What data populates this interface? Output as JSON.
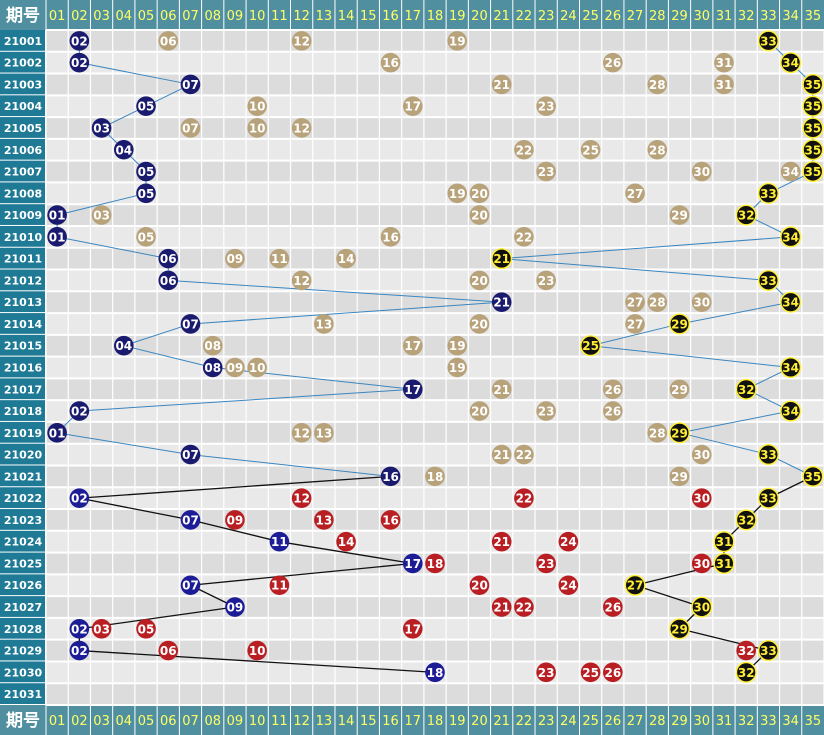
{
  "chart_data": {
    "type": "table",
    "header_label": "期号",
    "columns": [
      "01",
      "02",
      "03",
      "04",
      "05",
      "06",
      "07",
      "08",
      "09",
      "10",
      "11",
      "12",
      "13",
      "14",
      "15",
      "16",
      "17",
      "18",
      "19",
      "20",
      "21",
      "22",
      "23",
      "24",
      "25",
      "26",
      "27",
      "28",
      "29",
      "30",
      "31",
      "32",
      "33",
      "34",
      "35"
    ],
    "periods": [
      "21001",
      "21002",
      "21003",
      "21004",
      "21005",
      "21006",
      "21007",
      "21008",
      "21009",
      "21010",
      "21011",
      "21012",
      "21013",
      "21014",
      "21015",
      "21016",
      "21017",
      "21018",
      "21019",
      "21020",
      "21021",
      "21022",
      "21023",
      "21024",
      "21025",
      "21026",
      "21027",
      "21028",
      "21029",
      "21030",
      "21031"
    ],
    "line_series": [
      {
        "kind": "min",
        "values": [
          2,
          2,
          7,
          5,
          3,
          4,
          5,
          5,
          1,
          1,
          6,
          6,
          21,
          7,
          4,
          8,
          17,
          2,
          1,
          7,
          16,
          2,
          7,
          11,
          17,
          7,
          9,
          2,
          2,
          18
        ]
      },
      {
        "kind": "max",
        "values": [
          33,
          34,
          35,
          35,
          35,
          35,
          35,
          33,
          32,
          34,
          21,
          33,
          34,
          29,
          25,
          34,
          32,
          34,
          29,
          33,
          35,
          33,
          32,
          31,
          31,
          27,
          30,
          29,
          33,
          32
        ]
      }
    ],
    "other_numbers": [
      [
        6,
        12,
        19
      ],
      [
        16,
        26,
        31
      ],
      [
        21,
        28,
        31
      ],
      [
        10,
        17,
        23
      ],
      [
        7,
        10,
        12
      ],
      [
        22,
        25,
        28
      ],
      [
        23,
        30,
        34
      ],
      [
        19,
        20,
        27
      ],
      [
        3,
        20,
        29
      ],
      [
        5,
        16,
        22
      ],
      [
        9,
        11,
        14
      ],
      [
        12,
        20,
        23
      ],
      [
        27,
        28,
        30
      ],
      [
        13,
        20,
        27
      ],
      [
        8,
        17,
        19
      ],
      [
        9,
        10,
        19
      ],
      [
        21,
        26,
        29
      ],
      [
        20,
        23,
        26
      ],
      [
        12,
        13,
        28
      ],
      [
        21,
        22,
        30
      ],
      [
        18,
        29
      ],
      [
        12,
        22,
        30
      ],
      [
        9,
        13,
        16
      ],
      [
        14,
        21,
        24
      ],
      [
        18,
        23,
        30
      ],
      [
        11,
        20,
        24
      ],
      [
        21,
        22,
        26
      ],
      [
        3,
        5,
        17
      ],
      [
        6,
        10,
        32
      ],
      [
        23,
        25,
        26
      ]
    ],
    "colors": {
      "header_bg": "#4f8fa0",
      "header_text": "#ffff66",
      "period_bg": "#1f7a96",
      "row_bg_a": "#dcdcdc",
      "row_bg_b": "#e9e9e9",
      "min_ball": "#1a1a6e",
      "max_ball": "#111111",
      "max_ball_text": "#ffee33",
      "other_ball_normal": "#b8a27a",
      "other_ball_red": "#b81e22",
      "connector_normal": "#3a86c0",
      "connector_red": "#111111"
    },
    "red_style_from_index": 21
  }
}
